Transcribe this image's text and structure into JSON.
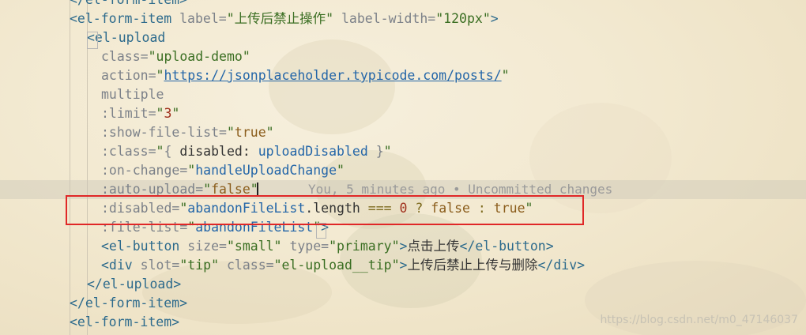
{
  "editor": {
    "lines": [
      {
        "indent": 88,
        "parts": [
          {
            "t": "</el-form-item>",
            "c": "tag"
          }
        ]
      },
      {
        "indent": 88,
        "parts": [
          {
            "t": "<el-form-item ",
            "c": "tag"
          },
          {
            "t": "label=",
            "c": "attr"
          },
          {
            "t": "\"上传后禁止操作\" ",
            "c": "str"
          },
          {
            "t": "label-width=",
            "c": "attr"
          },
          {
            "t": "\"120px\"",
            "c": "str"
          },
          {
            "t": ">",
            "c": "tag"
          }
        ]
      },
      {
        "indent": 110,
        "parts": [
          {
            "t": "<el-upload",
            "c": "tag"
          }
        ]
      },
      {
        "indent": 128,
        "parts": [
          {
            "t": "class=",
            "c": "attr"
          },
          {
            "t": "\"upload-demo\"",
            "c": "str"
          }
        ]
      },
      {
        "indent": 128,
        "parts": [
          {
            "t": "action=",
            "c": "attr"
          },
          {
            "t": "\"",
            "c": "str"
          },
          {
            "t": "https://jsonplaceholder.typicode.com/posts/",
            "c": "link"
          },
          {
            "t": "\"",
            "c": "str"
          }
        ]
      },
      {
        "indent": 128,
        "parts": [
          {
            "t": "multiple",
            "c": "attr"
          }
        ]
      },
      {
        "indent": 128,
        "parts": [
          {
            "t": ":limit=",
            "c": "attr"
          },
          {
            "t": "\"",
            "c": "str"
          },
          {
            "t": "3",
            "c": "num"
          },
          {
            "t": "\"",
            "c": "str"
          }
        ]
      },
      {
        "indent": 128,
        "parts": [
          {
            "t": ":show-file-list=",
            "c": "attr"
          },
          {
            "t": "\"",
            "c": "str"
          },
          {
            "t": "true",
            "c": "val"
          },
          {
            "t": "\"",
            "c": "str"
          }
        ]
      },
      {
        "indent": 128,
        "parts": [
          {
            "t": ":class=",
            "c": "attr"
          },
          {
            "t": "\"",
            "c": "str"
          },
          {
            "t": "{ ",
            "c": "attr"
          },
          {
            "t": "disabled: ",
            "c": "plain"
          },
          {
            "t": "uploadDisabled",
            "c": "strblue"
          },
          {
            "t": " }",
            "c": "attr"
          },
          {
            "t": "\"",
            "c": "str"
          }
        ]
      },
      {
        "indent": 128,
        "parts": [
          {
            "t": ":on-change=",
            "c": "attr"
          },
          {
            "t": "\"",
            "c": "str"
          },
          {
            "t": "handleUploadChange",
            "c": "strblue"
          },
          {
            "t": "\"",
            "c": "str"
          }
        ]
      },
      {
        "indent": 128,
        "parts": [
          {
            "t": ":auto-upload=",
            "c": "attr"
          },
          {
            "t": "\"",
            "c": "str"
          },
          {
            "t": "false",
            "c": "val"
          },
          {
            "t": "\"",
            "c": "str"
          }
        ]
      },
      {
        "indent": 128,
        "parts": [
          {
            "t": ":disabled=",
            "c": "attr"
          },
          {
            "t": "\"",
            "c": "str"
          },
          {
            "t": "abandonFileList",
            "c": "strblue"
          },
          {
            "t": ".length ",
            "c": "plain"
          },
          {
            "t": "=== ",
            "c": "op"
          },
          {
            "t": "0",
            "c": "num"
          },
          {
            "t": " ? ",
            "c": "op"
          },
          {
            "t": "false",
            "c": "val"
          },
          {
            "t": " : ",
            "c": "op"
          },
          {
            "t": "true",
            "c": "val"
          },
          {
            "t": "\"",
            "c": "str"
          }
        ]
      },
      {
        "indent": 128,
        "parts": [
          {
            "t": ":file-list=",
            "c": "attr"
          },
          {
            "t": "\"",
            "c": "str"
          },
          {
            "t": "abandonFileList",
            "c": "strblue"
          },
          {
            "t": "\"",
            "c": "str"
          },
          {
            "t": ">",
            "c": "tag"
          }
        ]
      },
      {
        "indent": 128,
        "parts": [
          {
            "t": "<el-button ",
            "c": "tag"
          },
          {
            "t": "size=",
            "c": "attr"
          },
          {
            "t": "\"small\" ",
            "c": "str"
          },
          {
            "t": "type=",
            "c": "attr"
          },
          {
            "t": "\"primary\"",
            "c": "str"
          },
          {
            "t": ">",
            "c": "tag"
          },
          {
            "t": "点击上传",
            "c": "plain"
          },
          {
            "t": "</el-button>",
            "c": "tag"
          }
        ]
      },
      {
        "indent": 128,
        "parts": [
          {
            "t": "<div ",
            "c": "tag"
          },
          {
            "t": "slot=",
            "c": "attr"
          },
          {
            "t": "\"tip\" ",
            "c": "str"
          },
          {
            "t": "class=",
            "c": "attr"
          },
          {
            "t": "\"el-upload__tip\"",
            "c": "str"
          },
          {
            "t": ">",
            "c": "tag"
          },
          {
            "t": "上传后禁止上传与删除",
            "c": "plain"
          },
          {
            "t": "</div>",
            "c": "tag"
          }
        ]
      },
      {
        "indent": 110,
        "parts": [
          {
            "t": "</el-upload>",
            "c": "tag"
          }
        ]
      },
      {
        "indent": 88,
        "parts": [
          {
            "t": "</el-form-item>",
            "c": "tag"
          }
        ]
      },
      {
        "indent": 88,
        "parts": [
          {
            "t": "<el-form-item>",
            "c": "tag"
          }
        ]
      }
    ],
    "blame_text": "You, 5 minutes ago • Uncommitted changes"
  },
  "watermark": "https://blog.csdn.net/m0_47146037"
}
